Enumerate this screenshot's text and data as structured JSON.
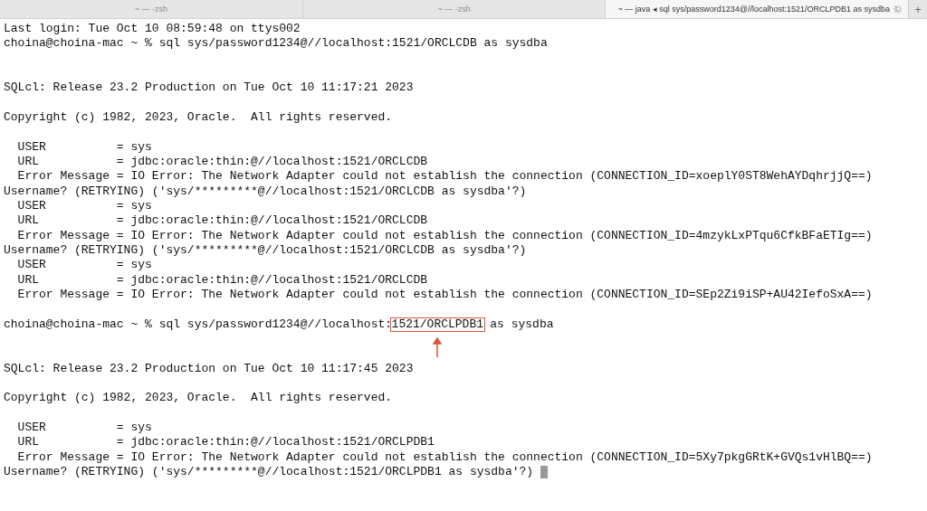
{
  "tabs": [
    {
      "title": "~ — -zsh",
      "selected": false,
      "busy": false
    },
    {
      "title": "~ — -zsh",
      "selected": false,
      "busy": false
    },
    {
      "title": "~ — java ◂ sql sys/password1234@//localhost:1521/ORCLPDB1 as sysdba",
      "selected": true,
      "busy": true
    }
  ],
  "new_tab": "+",
  "lines": [
    {
      "kind": "text",
      "parts": [
        {
          "text": "Last login: Tue Oct 10 08:59:48 on ttys002",
          "boxed": false
        }
      ]
    },
    {
      "kind": "text",
      "parts": [
        {
          "text": "choina@choina-mac ~ % sql sys/password1234@//localhost:1521/ORCLCDB as sysdba",
          "boxed": false
        }
      ]
    },
    {
      "kind": "blank"
    },
    {
      "kind": "blank"
    },
    {
      "kind": "text",
      "parts": [
        {
          "text": "SQLcl: Release 23.2 Production on Tue Oct 10 11:17:21 2023",
          "boxed": false
        }
      ]
    },
    {
      "kind": "blank"
    },
    {
      "kind": "text",
      "parts": [
        {
          "text": "Copyright (c) 1982, 2023, Oracle.  All rights reserved.",
          "boxed": false
        }
      ]
    },
    {
      "kind": "blank"
    },
    {
      "kind": "text",
      "parts": [
        {
          "text": "  USER          = sys",
          "boxed": false
        }
      ]
    },
    {
      "kind": "text",
      "parts": [
        {
          "text": "  URL           = jdbc:oracle:thin:@//localhost:1521/ORCLCDB",
          "boxed": false
        }
      ]
    },
    {
      "kind": "text",
      "parts": [
        {
          "text": "  Error Message = IO Error: The Network Adapter could not establish the connection (CONNECTION_ID=xoeplY0ST8WehAYDqhrjjQ==)",
          "boxed": false
        }
      ]
    },
    {
      "kind": "text",
      "parts": [
        {
          "text": "Username? (RETRYING) ('sys/*********@//localhost:1521/ORCLCDB as sysdba'?)",
          "boxed": false
        }
      ]
    },
    {
      "kind": "text",
      "parts": [
        {
          "text": "  USER          = sys",
          "boxed": false
        }
      ]
    },
    {
      "kind": "text",
      "parts": [
        {
          "text": "  URL           = jdbc:oracle:thin:@//localhost:1521/ORCLCDB",
          "boxed": false
        }
      ]
    },
    {
      "kind": "text",
      "parts": [
        {
          "text": "  Error Message = IO Error: The Network Adapter could not establish the connection (CONNECTION_ID=4mzykLxPTqu6CfkBFaETIg==)",
          "boxed": false
        }
      ]
    },
    {
      "kind": "text",
      "parts": [
        {
          "text": "Username? (RETRYING) ('sys/*********@//localhost:1521/ORCLCDB as sysdba'?)",
          "boxed": false
        }
      ]
    },
    {
      "kind": "text",
      "parts": [
        {
          "text": "  USER          = sys",
          "boxed": false
        }
      ]
    },
    {
      "kind": "text",
      "parts": [
        {
          "text": "  URL           = jdbc:oracle:thin:@//localhost:1521/ORCLCDB",
          "boxed": false
        }
      ]
    },
    {
      "kind": "text",
      "parts": [
        {
          "text": "  Error Message = IO Error: The Network Adapter could not establish the connection (CONNECTION_ID=SEp2Zi9iSP+AU42IefoSxA==)",
          "boxed": false
        }
      ]
    },
    {
      "kind": "blank"
    },
    {
      "kind": "text",
      "parts": [
        {
          "text": "choina@choina-mac ~ % sql sys/password1234@//localhost:",
          "boxed": false
        },
        {
          "text": "1521/ORCLPDB1",
          "boxed": true
        },
        {
          "text": " as sysdba",
          "boxed": false
        }
      ]
    },
    {
      "kind": "blank"
    },
    {
      "kind": "blank"
    },
    {
      "kind": "text",
      "parts": [
        {
          "text": "SQLcl: Release 23.2 Production on Tue Oct 10 11:17:45 2023",
          "boxed": false
        }
      ]
    },
    {
      "kind": "blank"
    },
    {
      "kind": "text",
      "parts": [
        {
          "text": "Copyright (c) 1982, 2023, Oracle.  All rights reserved.",
          "boxed": false
        }
      ]
    },
    {
      "kind": "blank"
    },
    {
      "kind": "text",
      "parts": [
        {
          "text": "  USER          = sys",
          "boxed": false
        }
      ]
    },
    {
      "kind": "text",
      "parts": [
        {
          "text": "  URL           = jdbc:oracle:thin:@//localhost:1521/ORCLPDB1",
          "boxed": false
        }
      ]
    },
    {
      "kind": "text",
      "parts": [
        {
          "text": "  Error Message = IO Error: The Network Adapter could not establish the connection (CONNECTION_ID=5Xy7pkgGRtK+GVQs1vHlBQ==)",
          "boxed": false
        }
      ]
    },
    {
      "kind": "text",
      "cursor": true,
      "parts": [
        {
          "text": "Username? (RETRYING) ('sys/*********@//localhost:1521/ORCLPDB1 as sysdba'?) ",
          "boxed": false
        }
      ]
    }
  ]
}
